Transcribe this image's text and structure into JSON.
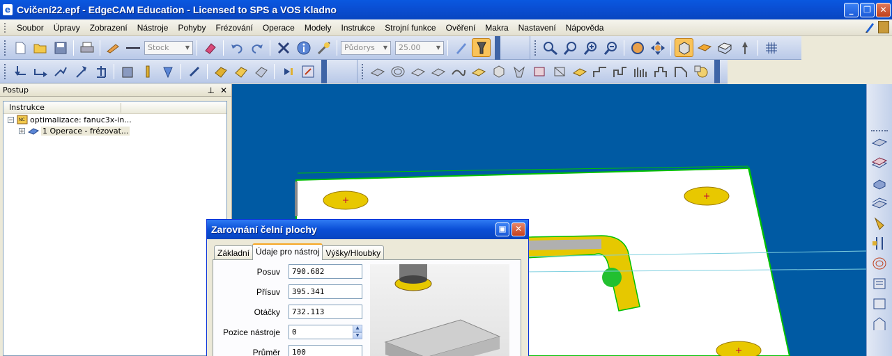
{
  "window": {
    "title": "Cvičení22.epf - EdgeCAM Education - Licensed to SPS a VOS Kladno",
    "app_icon_glyph": "e"
  },
  "menu": {
    "items": [
      "Soubor",
      "Úpravy",
      "Zobrazení",
      "Nástroje",
      "Pohyby",
      "Frézování",
      "Operace",
      "Modely",
      "Instrukce",
      "Strojní funkce",
      "Ověření",
      "Makra",
      "Nastavení",
      "Nápověda"
    ]
  },
  "toolbar": {
    "stock_combo": "Stock",
    "view_combo": "Půdorys",
    "value_combo": "25.00"
  },
  "left_panel": {
    "title": "Postup",
    "pin_glyph": "⊥",
    "close_glyph": "✕",
    "column_header": "Instrukce",
    "tree": [
      {
        "label": "optimalizace: fanuc3x-in...",
        "expander": "−"
      },
      {
        "label": "1 Operace - frézovat...",
        "expander": "+"
      }
    ]
  },
  "dialog": {
    "title": "Zarovnání čelní plochy",
    "tabs": [
      "Základní",
      "Údaje pro nástroj",
      "Výšky/Hloubky"
    ],
    "active_tab": 1,
    "fields": [
      {
        "label": "Posuv",
        "value": "790.682"
      },
      {
        "label": "Přísuv",
        "value": "395.341"
      },
      {
        "label": "Otáčky",
        "value": "732.113"
      },
      {
        "label": "Pozice nástroje",
        "value": "0"
      },
      {
        "label": "Průměr",
        "value": "100"
      }
    ]
  },
  "colors": {
    "viewport_bg": "#005aa3",
    "part_face": "#ffffff",
    "part_edge": "#00c000",
    "hole_fill": "#e8c800",
    "accent_orange": "#f9c35a"
  }
}
